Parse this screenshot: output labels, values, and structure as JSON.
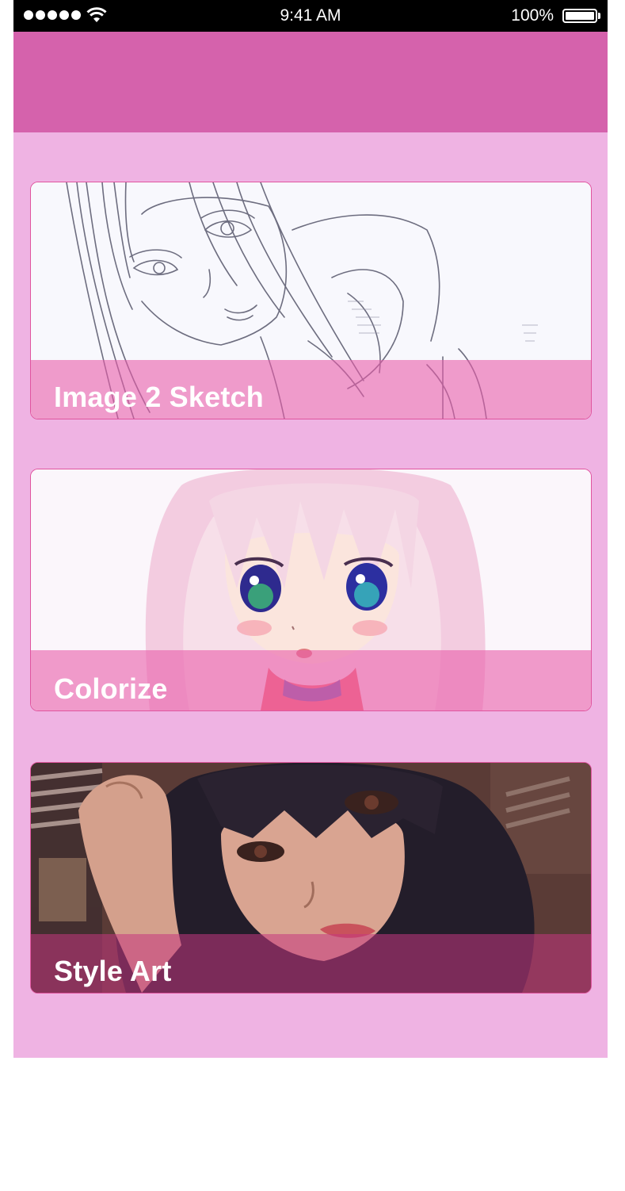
{
  "status_bar": {
    "time": "9:41 AM",
    "battery_percent": "100%",
    "signal_bars": 5
  },
  "nav_bar": {
    "color": "#d562ac"
  },
  "theme": {
    "background": "#efb3e3",
    "accent": "#e0559f"
  },
  "cards": [
    {
      "label": "Image 2 Sketch",
      "image": "pencil-sketch-portrait"
    },
    {
      "label": "Colorize",
      "image": "colorized-anime-girl"
    },
    {
      "label": "Style Art",
      "image": "stylized-photo-portrait"
    }
  ]
}
